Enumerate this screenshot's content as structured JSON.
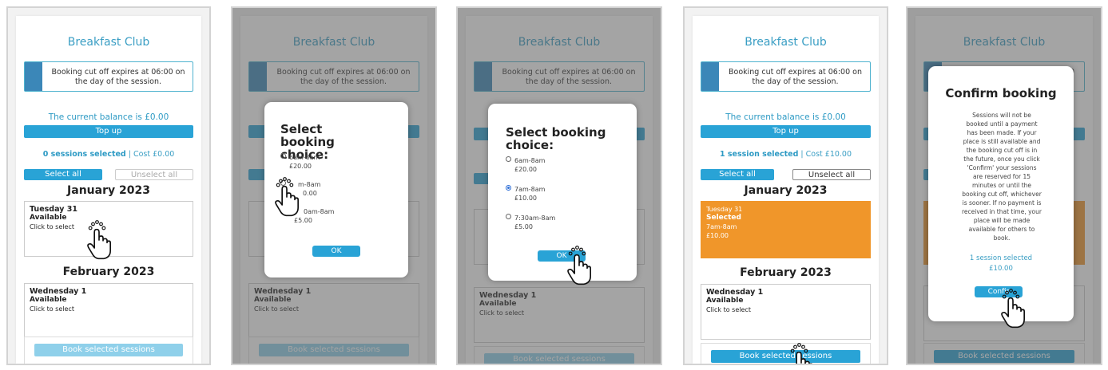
{
  "app": {
    "title": "Breakfast Club",
    "cutoff": "Booking cut off expires at 06:00 on the day of the session.",
    "balance": "The current balance is £0.00",
    "topup": "Top up",
    "select_all": "Select all",
    "unselect_all": "Unselect all",
    "book": "Book selected sessions"
  },
  "months": {
    "jan": "January 2023",
    "feb": "February 2023"
  },
  "days": {
    "tue": {
      "name": "Tuesday 31",
      "status": "Available",
      "hint": "Click to select"
    },
    "wed": {
      "name": "Wednesday 1",
      "status": "Available",
      "hint": "Click to select"
    },
    "tue_selected": {
      "name": "Tuesday 31",
      "status": "Selected",
      "time": "7am-8am",
      "price": "£10.00"
    }
  },
  "summary": {
    "none": {
      "count": "0 sessions selected",
      "cost": " | Cost £0.00"
    },
    "one": {
      "count": "1 session selected",
      "cost": " | Cost £10.00"
    }
  },
  "booking_modal": {
    "title": "Select booking choice:",
    "options": [
      {
        "time": "6am-8am",
        "price": "£20.00"
      },
      {
        "time": "7am-8am",
        "price": "£10.00"
      },
      {
        "time": "7:30am-8am",
        "price": "£5.00"
      }
    ],
    "panel2_partial": [
      {
        "time": "6am-8am",
        "price": "£20.00"
      },
      {
        "time": "m-8am",
        "price": "0.00"
      },
      {
        "time": "0am-8am",
        "price": "£5.00"
      }
    ],
    "ok": "OK",
    "ok_partial": "OK"
  },
  "confirm_modal": {
    "title": "Confirm booking",
    "body": "Sessions will not be booked until a payment has been made. If your place is still available and the booking cut off is in the future, once you click 'Confirm' your sessions are reserved for 15 minutes or until the booking cut off, whichever is sooner. If no payment is received in that time, your place will be made available for others to book.",
    "selected": "1 session selected",
    "cost": "£10.00",
    "button": "Confirm",
    "button_partial": "Confir"
  },
  "colors": {
    "accent": "#29a3d6",
    "selected_day": "#f0962a",
    "title": "#3a9ec4"
  },
  "icons": [
    "pointer-hand-icon",
    "radio-icon"
  ]
}
